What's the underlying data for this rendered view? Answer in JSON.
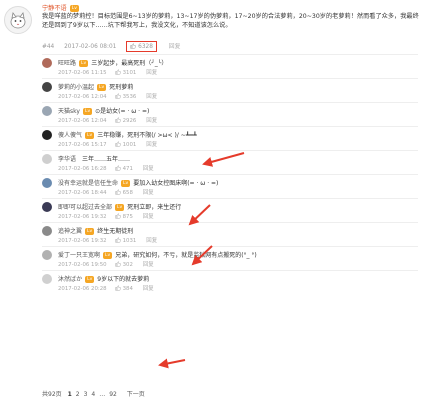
{
  "post": {
    "avatar_label": "",
    "author": "宁静不语",
    "level": "Lv",
    "text": "我是咩蓝的梦莉控！目标范围是6~13岁的萝莉，13~17岁的伪萝莉，17~20岁的合法萝莉，20~30岁的老萝莉！然而看了众多，我最终还是回到了9岁以下……坑下帮我写上，我没文化，不知道该怎么说。",
    "floor": "#44",
    "date": "2017-02-06 08:01",
    "likes": "6328",
    "reply": "回复"
  },
  "comments": [
    {
      "user": "旺旺路",
      "badge": "Lv",
      "text": "三岁起步，最高死刑（╯_╰）",
      "date": "2017-02-06 11:15",
      "likes": "3101",
      "reply": "回复",
      "avatar_color": "#b06a5a"
    },
    {
      "user": "萝莉的小温起",
      "badge": "Lv",
      "text": "死刑萝莉",
      "date": "2017-02-06 12:04",
      "likes": "3536",
      "reply": "回复",
      "avatar_color": "#444444"
    },
    {
      "user": "天猫sky",
      "badge": "Lv",
      "text": "⊙是幼女(= · ω · =)",
      "date": "2017-02-06 12:04",
      "likes": "2926",
      "reply": "回复",
      "avatar_color": "#9aa6b3"
    },
    {
      "user": "傻人傻气",
      "badge": "Lv",
      "text": "三年稳赚，死刑不限(/ >ω< )/ ~┻━┻",
      "date": "2017-02-06 15:17",
      "likes": "1001",
      "reply": "回复",
      "avatar_color": "#222222"
    },
    {
      "user": "李华语",
      "badge": "",
      "text": "三年……五年……",
      "date": "2017-02-06 16:28",
      "likes": "471",
      "reply": "回复",
      "avatar_color": "#cfcfcf"
    },
    {
      "user": "没有幸运就是信任生命",
      "badge": "Lv",
      "text": "要加入幼女控图床啊(= · ω · =)",
      "date": "2017-02-06 18:44",
      "likes": "658",
      "reply": "回复",
      "avatar_color": "#6a8bb0"
    },
    {
      "user": "即即可以超过去全部",
      "badge": "Lv",
      "text": "死刑立即，来生还行",
      "date": "2017-02-06 19:32",
      "likes": "875",
      "reply": "回复",
      "avatar_color": "#3a3a55"
    },
    {
      "user": "追神之翼",
      "badge": "Lv",
      "text": "终生无期徒刑",
      "date": "2017-02-06 19:32",
      "likes": "1031",
      "reply": "回复",
      "avatar_color": "#8a8a8a"
    },
    {
      "user": "爱丁一只王宽啊",
      "badge": "Lv",
      "text": "兄弟，研究如何，不亏，就是监狱网有点搬死的(°_ °)",
      "date": "2017-02-06 19:50",
      "likes": "302",
      "reply": "回复",
      "avatar_color": "#b1b1b1"
    },
    {
      "user": "沐然ばか",
      "badge": "Lv",
      "text": "9岁以下的就去萝莉",
      "date": "2017-02-06 20:28",
      "likes": "384",
      "reply": "回复",
      "avatar_color": "#d0d0d0"
    }
  ],
  "pager": {
    "prefix": "共92页",
    "pages": [
      "1",
      "2",
      "3",
      "4",
      "…",
      "92"
    ],
    "next": "下一页"
  },
  "colors": {
    "accent": "#e0562b",
    "arrow": "#e53b2b",
    "badge": "#f5a623"
  },
  "icons": {
    "thumb": "thumb-up-icon",
    "arrow": "red-arrow-annotation"
  }
}
